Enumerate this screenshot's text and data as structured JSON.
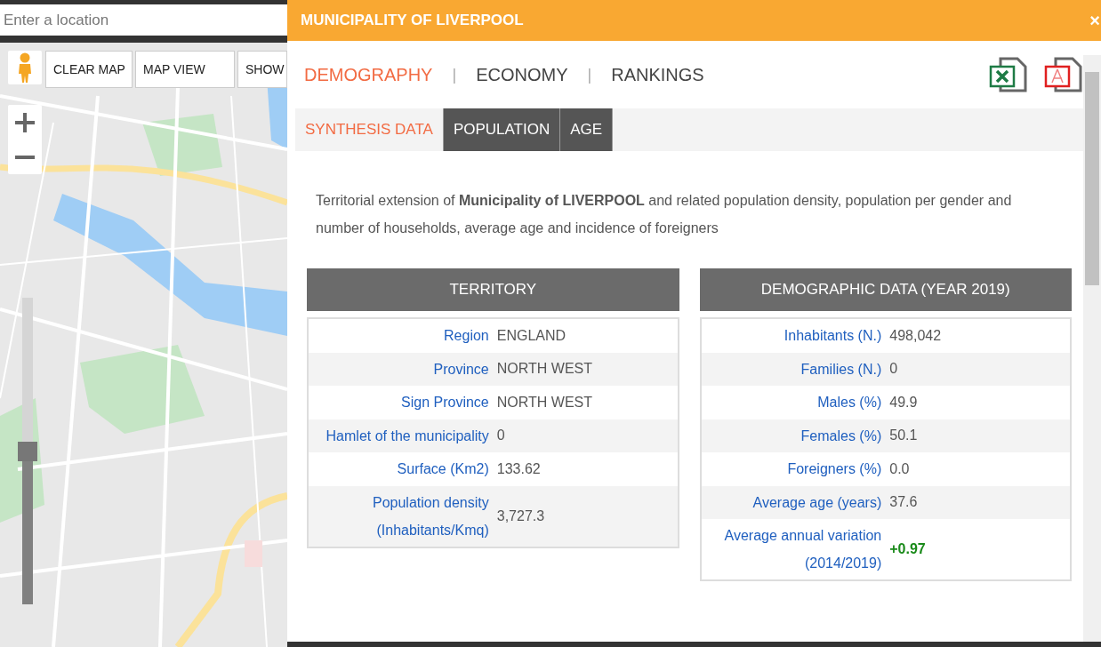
{
  "search": {
    "placeholder": "Enter a location"
  },
  "map_controls": {
    "buttons": [
      "CLEAR MAP",
      "MAP VIEW",
      "SHOW"
    ],
    "zoom_slider": {
      "level": 0.5
    }
  },
  "panel": {
    "title": "MUNICIPALITY OF LIVERPOOL",
    "close": "×",
    "main_tabs": [
      {
        "label": "DEMOGRAPHY",
        "selected": true
      },
      {
        "label": "ECONOMY",
        "selected": false
      },
      {
        "label": "RANKINGS",
        "selected": false
      }
    ],
    "separator": "|",
    "sub_tabs": [
      {
        "label": "SYNTHESIS DATA",
        "selected": true
      },
      {
        "label": "POPULATION",
        "selected": false
      },
      {
        "label": "AGE",
        "selected": false
      }
    ],
    "intro": "Territorial extension of **Municipality of LIVERPOOL** and related population density, population per gender and number of households, average age and incidence of foreigners",
    "tables": [
      {
        "heading": "TERRITORY",
        "rows": [
          {
            "label": "Region",
            "value": "ENGLAND",
            "emphasis": false
          },
          {
            "label": "Province",
            "value": "NORTH WEST",
            "emphasis": false
          },
          {
            "label": "Sign Province",
            "value": "NORTH WEST",
            "emphasis": false
          },
          {
            "label": "Hamlet of the municipality",
            "value": "0",
            "emphasis": false
          },
          {
            "label": "Surface (Km2)",
            "value": "133.62",
            "emphasis": false
          },
          {
            "label": "Population density (Inhabitants/Kmq)",
            "value": "3,727.3",
            "emphasis": false
          }
        ]
      },
      {
        "heading": "DEMOGRAPHIC DATA (YEAR 2019)",
        "rows": [
          {
            "label": "Inhabitants (N.)",
            "value": "498,042",
            "emphasis": false
          },
          {
            "label": "Families (N.)",
            "value": "0",
            "emphasis": false
          },
          {
            "label": "Males (%)",
            "value": "49.9",
            "emphasis": false
          },
          {
            "label": "Females (%)",
            "value": "50.1",
            "emphasis": false
          },
          {
            "label": "Foreigners (%)",
            "value": "0.0",
            "emphasis": false
          },
          {
            "label": "Average age (years)",
            "value": "37.6",
            "emphasis": false
          },
          {
            "label": "Average annual variation (2014/2019)",
            "value": "+0.97",
            "emphasis": true
          }
        ]
      }
    ]
  }
}
